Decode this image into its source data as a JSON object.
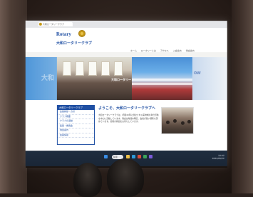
{
  "tab": {
    "title": "大和ロータリークラブ"
  },
  "site": {
    "logo": "Rotary",
    "club_name": "大和ロータリークラブ",
    "nav": [
      "ホーム",
      "ロータリーとは",
      "アクセス",
      "入会案内",
      "例会案内"
    ]
  },
  "hero": {
    "overlay": "大和ロータリー",
    "side_left": "大和",
    "side_right": "OW"
  },
  "sidebar": {
    "title": "大和ロータリークラブ",
    "items": [
      "会長挨拶・方針",
      "クラブ概要",
      "クラブの活動",
      "役員・委員会",
      "例会案内",
      "会員情報"
    ]
  },
  "welcome": {
    "heading": "ようこそ、大和ロータリークラブへ",
    "body": "大和ロータリークラブは、昭和40年に創立され以来地域の奉仕活動を中心に活動しています。例会は毎週水曜日、会員が集い親睦を深めています。皆様の参加をお待ちしています。"
  },
  "taskbar": {
    "search": "検索",
    "time": "10:42",
    "date": "2024/05/22"
  },
  "colors": {
    "brand_blue": "#1f4fa3",
    "rotary_gold": "#c79a18"
  }
}
